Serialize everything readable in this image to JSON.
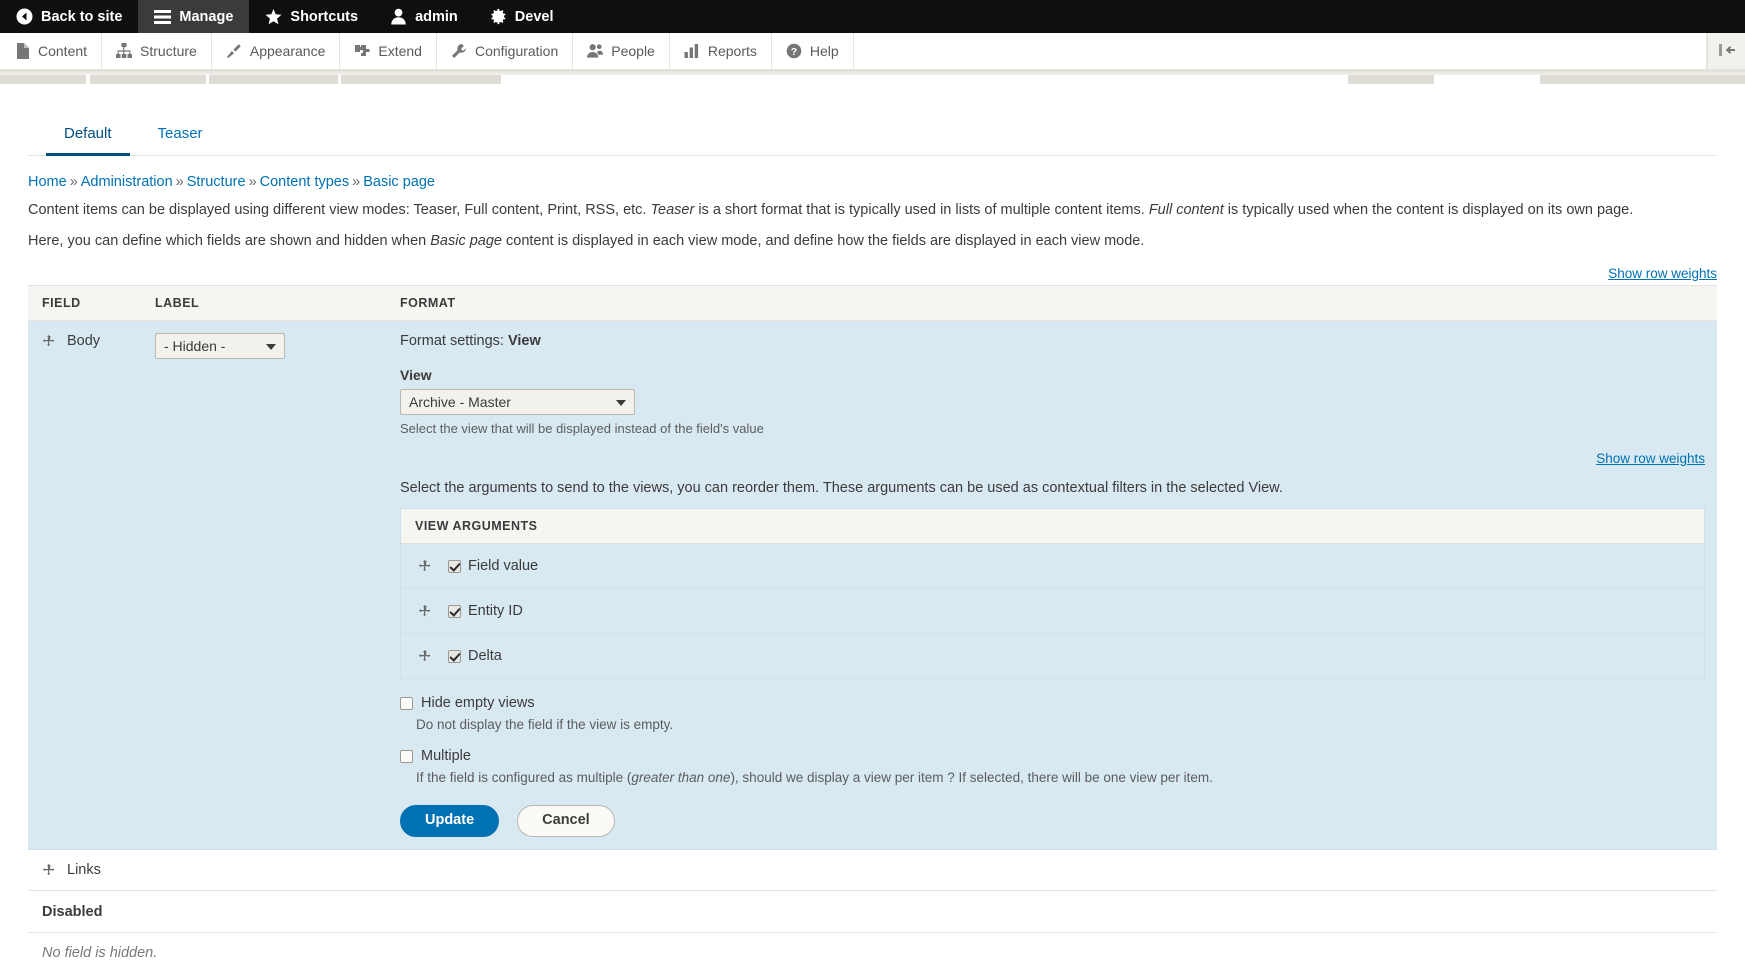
{
  "toolbar": {
    "items": [
      {
        "label": "Back to site",
        "icon": "back-arrow-icon",
        "active": false
      },
      {
        "label": "Manage",
        "icon": "hamburger-icon",
        "active": true
      },
      {
        "label": "Shortcuts",
        "icon": "star-icon",
        "active": false
      },
      {
        "label": "admin",
        "icon": "user-icon",
        "active": false
      },
      {
        "label": "Devel",
        "icon": "gear-icon",
        "active": false
      }
    ]
  },
  "admin_menu": {
    "items": [
      {
        "label": "Content",
        "icon": "file-icon"
      },
      {
        "label": "Structure",
        "icon": "sitemap-icon"
      },
      {
        "label": "Appearance",
        "icon": "paintbrush-icon"
      },
      {
        "label": "Extend",
        "icon": "puzzle-icon"
      },
      {
        "label": "Configuration",
        "icon": "wrench-icon"
      },
      {
        "label": "People",
        "icon": "people-icon"
      },
      {
        "label": "Reports",
        "icon": "barchart-icon"
      },
      {
        "label": "Help",
        "icon": "question-icon"
      }
    ],
    "orientation_toggle": "orientation-toggle-icon"
  },
  "view_mode_tabs": [
    {
      "label": "Default",
      "active": true
    },
    {
      "label": "Teaser",
      "active": false
    }
  ],
  "breadcrumb": [
    "Home",
    "Administration",
    "Structure",
    "Content types",
    "Basic page"
  ],
  "breadcrumb_separator": "»",
  "descriptions": {
    "para1_a": "Content items can be displayed using different view modes: Teaser, Full content, Print, RSS, etc. ",
    "para1_em1": "Teaser",
    "para1_b": " is a short format that is typically used in lists of multiple content items. ",
    "para1_em2": "Full content",
    "para1_c": " is typically used when the content is displayed on its own page.",
    "para2_a": "Here, you can define which fields are shown and hidden when ",
    "para2_em": "Basic page",
    "para2_b": " content is displayed in each view mode, and define how the fields are displayed in each view mode."
  },
  "show_row_weights_top": "Show row weights",
  "show_row_weights_inner": "Show row weights",
  "table": {
    "headers": {
      "field": "Field",
      "label": "Label",
      "format": "Format"
    },
    "rows": [
      {
        "name": "Body",
        "label_select": "- Hidden -"
      },
      {
        "name": "Links"
      }
    ]
  },
  "format_settings": {
    "title_prefix": "Format settings:",
    "title_value": "View",
    "view_label": "View",
    "view_select": "Archive - Master",
    "view_help": "Select the view that will be displayed instead of the field's value",
    "args_intro": "Select the arguments to send to the views, you can reorder them. These arguments can be used as contextual filters in the selected View.",
    "args_table_header": "View arguments",
    "arguments": [
      {
        "label": "Field value",
        "checked": true
      },
      {
        "label": "Entity ID",
        "checked": true
      },
      {
        "label": "Delta",
        "checked": true
      }
    ],
    "hide_empty": {
      "label": "Hide empty views",
      "checked": false,
      "help": "Do not display the field if the view is empty."
    },
    "multiple": {
      "label": "Multiple",
      "checked": false,
      "help_a": "If the field is configured as multiple (",
      "help_em": "greater than one",
      "help_b": "), should we display a view per item ? If selected, there will be one view per item."
    },
    "update_button": "Update",
    "cancel_button": "Cancel"
  },
  "disabled_region": {
    "title": "Disabled",
    "empty_text": "No field is hidden."
  },
  "colors": {
    "toolbar_bg": "#0f0f0f",
    "toolbar_active": "#3b3b3b",
    "link": "#0071b3",
    "highlight_row": "#d9e9f2",
    "header_bg": "#f5f5f2"
  }
}
